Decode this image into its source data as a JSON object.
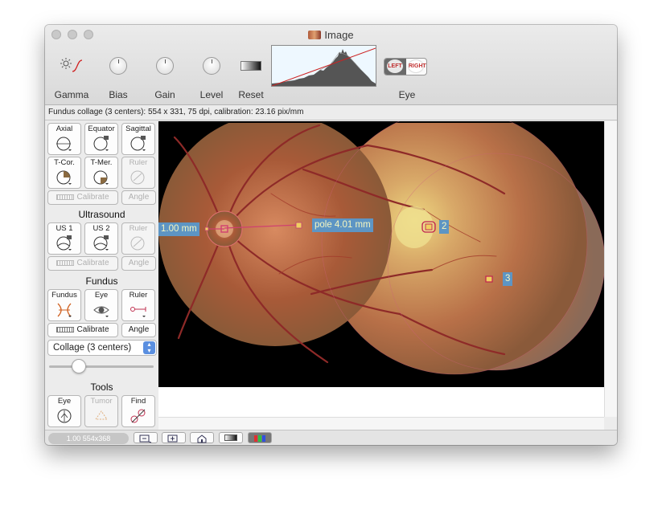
{
  "window": {
    "title": "Image"
  },
  "toolbar": {
    "gamma_label": "Gamma",
    "bias_label": "Bias",
    "gain_label": "Gain",
    "level_label": "Level",
    "reset_label": "Reset",
    "eye_label": "Eye",
    "eye_left": "LEFT",
    "eye_right": "RIGHT"
  },
  "status": {
    "text": "Fundus collage (3 centers): 554 x 331, 75 dpi, calibration: 23.16 pix/mm"
  },
  "sidebar": {
    "buttons_top": [
      {
        "label": "Axial"
      },
      {
        "label": "Equator"
      },
      {
        "label": "Sagittal"
      },
      {
        "label": "T-Cor."
      },
      {
        "label": "T-Mer."
      },
      {
        "label": "Ruler"
      }
    ],
    "calibrate_label": "Calibrate",
    "angle_label": "Angle",
    "ultrasound_title": "Ultrasound",
    "ultrasound_buttons": [
      {
        "label": "US 1"
      },
      {
        "label": "US 2"
      },
      {
        "label": "Ruler"
      }
    ],
    "fundus_title": "Fundus",
    "fundus_buttons": [
      {
        "label": "Fundus"
      },
      {
        "label": "Eye"
      },
      {
        "label": "Ruler"
      }
    ],
    "select_value": "Collage (3 centers)",
    "slider_value": 0.25,
    "tools_title": "Tools",
    "tools_buttons": [
      {
        "label": "Eye"
      },
      {
        "label": "Tumor"
      },
      {
        "label": "Find"
      }
    ]
  },
  "annotations": {
    "measure_left": "1.00 mm",
    "measure_pole": "pole 4.01 mm",
    "center_2": "2",
    "center_3": "3"
  },
  "bottom": {
    "zoom_text": "1.00 554x368"
  },
  "colors": {
    "annotation_bg": "#5d95c4",
    "annotation_fg": "#f6f6c0",
    "marker": "#d04070"
  }
}
